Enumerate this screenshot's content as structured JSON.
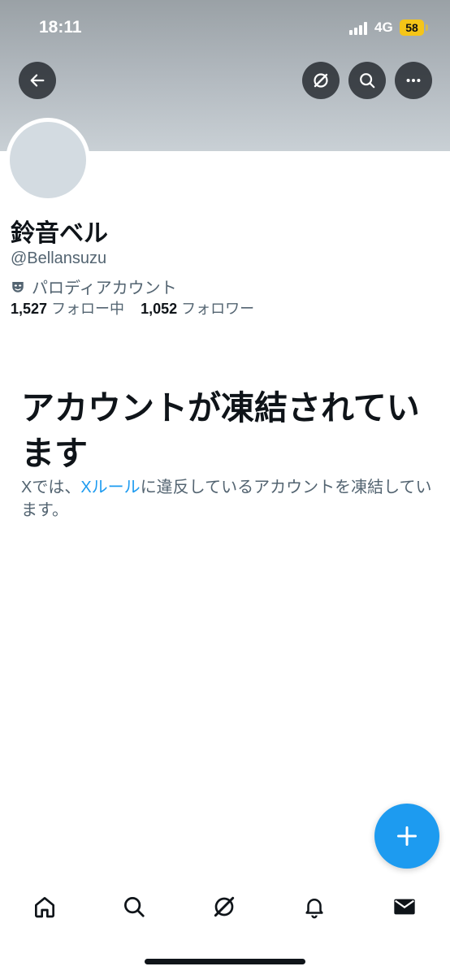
{
  "status_bar": {
    "time": "18:11",
    "network": "4G",
    "battery": "58"
  },
  "header": {
    "back_icon": "arrow-left-icon",
    "grok_icon": "grok-icon",
    "search_icon": "search-icon",
    "more_icon": "more-icon"
  },
  "profile": {
    "display_name": "鈴音ベル",
    "handle": "@Bellansuzu",
    "parody_label": "パロディアカウント",
    "following_count": "1,527",
    "following_label": "フォロー中",
    "followers_count": "1,052",
    "followers_label": "フォロワー"
  },
  "suspended": {
    "headline": "アカウントが凍結されています",
    "desc_before": "Xでは、",
    "desc_link": "Xルール",
    "desc_after": "に違反しているアカウントを凍結しています。"
  },
  "fab": {
    "icon": "plus-icon"
  },
  "bottom_nav": {
    "items": [
      {
        "name": "home",
        "icon": "home-icon"
      },
      {
        "name": "search",
        "icon": "search-icon"
      },
      {
        "name": "grok",
        "icon": "grok-icon"
      },
      {
        "name": "notifications",
        "icon": "bell-icon"
      },
      {
        "name": "messages",
        "icon": "mail-icon"
      }
    ]
  },
  "colors": {
    "accent": "#1d9bf0",
    "text": "#0f1419",
    "muted": "#536471",
    "avatar": "#d3dbe1"
  }
}
